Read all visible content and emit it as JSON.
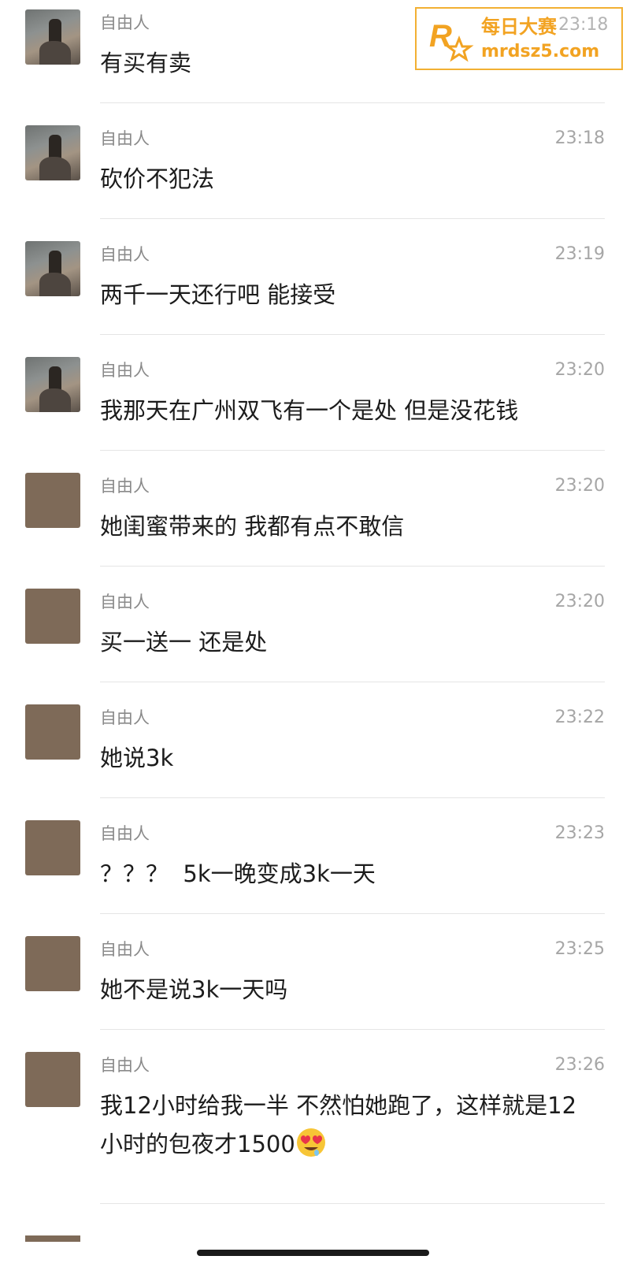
{
  "watermark": {
    "line1": "每日大赛",
    "line2": "mrdsz5.com",
    "logo_letter": "R",
    "color": "#f2a322"
  },
  "messages": [
    {
      "sender": "自由人",
      "time": "23:18",
      "text": "有买有卖",
      "avatar": "photo"
    },
    {
      "sender": "自由人",
      "time": "23:18",
      "text": "砍价不犯法",
      "avatar": "photo"
    },
    {
      "sender": "自由人",
      "time": "23:19",
      "text": "两千一天还行吧 能接受",
      "avatar": "photo"
    },
    {
      "sender": "自由人",
      "time": "23:20",
      "text": "我那天在广州双飞有一个是处 但是没花钱",
      "avatar": "photo"
    },
    {
      "sender": "自由人",
      "time": "23:20",
      "text": "她闺蜜带来的 我都有点不敢信",
      "avatar": "plain"
    },
    {
      "sender": "自由人",
      "time": "23:20",
      "text": "买一送一 还是处",
      "avatar": "plain"
    },
    {
      "sender": "自由人",
      "time": "23:22",
      "text": "她说3k",
      "avatar": "plain"
    },
    {
      "sender": "自由人",
      "time": "23:23",
      "text": "？？？  5k一晚变成3k一天",
      "avatar": "plain"
    },
    {
      "sender": "自由人",
      "time": "23:25",
      "text": "她不是说3k一天吗",
      "avatar": "plain"
    },
    {
      "sender": "自由人",
      "time": "23:26",
      "text": "我12小时给我一半 不然怕她跑了，这样就是12小时的包夜才1500",
      "emoji": "heart-eyes-drooling-emoji",
      "avatar": "plain"
    }
  ],
  "colors": {
    "avatar_plain": "#7e6a58",
    "sender": "#8a8a8a",
    "time": "#a6a6a6",
    "text": "#1c1c1c",
    "divider": "#e5e5e5"
  }
}
